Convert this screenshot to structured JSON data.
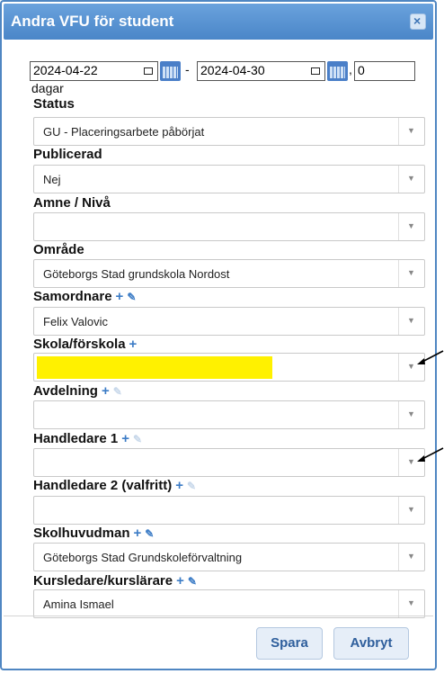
{
  "dialog": {
    "title": "Andra VFU för student",
    "close_icon": "close-icon"
  },
  "dates": {
    "start": "2024-04-22",
    "end": "2024-04-30",
    "separator": "-",
    "comma": ",",
    "days_value": "0",
    "days_label": "dagar"
  },
  "fields": {
    "status": {
      "label": "Status",
      "value": "GU - Placeringsarbete påbörjat"
    },
    "publicerad": {
      "label": "Publicerad",
      "value": "Nej"
    },
    "amne": {
      "label": "Amne / Nivå",
      "value": ""
    },
    "omrade": {
      "label": "Område",
      "value": "Göteborgs Stad grundskola Nordost"
    },
    "samordnare": {
      "label": "Samordnare",
      "value": "Felix Valovic"
    },
    "skola": {
      "label": "Skola/förskola",
      "value": ""
    },
    "avdelning": {
      "label": "Avdelning",
      "value": ""
    },
    "handledare1": {
      "label": "Handledare 1",
      "value": ""
    },
    "handledare2": {
      "label": "Handledare 2 (valfritt)",
      "value": ""
    },
    "skolhuvudman": {
      "label": "Skolhuvudman",
      "value": "Göteborgs Stad Grundskoleförvaltning"
    },
    "kursledare": {
      "label": "Kursledare/kurslärare",
      "value": "Amina Ismael"
    }
  },
  "icons": {
    "plus": "+",
    "pencil": "✎",
    "dropdown": "▼"
  },
  "buttons": {
    "save": "Spara",
    "cancel": "Avbryt"
  },
  "colors": {
    "titlebar": "#4a86c8",
    "highlight": "#fff100",
    "accent": "#3c7cc6"
  }
}
